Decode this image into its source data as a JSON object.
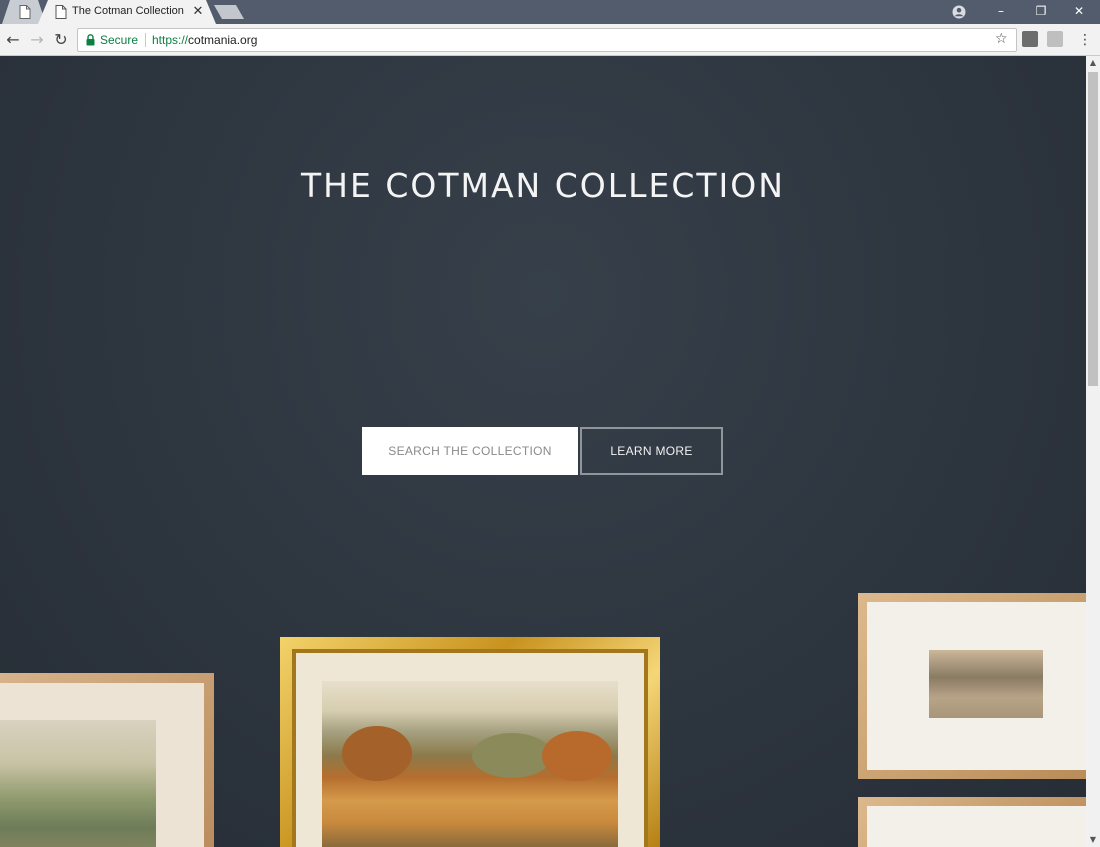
{
  "browser": {
    "tabs": [
      {
        "title": "",
        "active": false
      },
      {
        "title": "The Cotman Collection | ",
        "active": true
      }
    ],
    "tab_close_glyph": "✕",
    "window_controls": {
      "minimize": "–",
      "maximize": "❐",
      "close": "✕"
    },
    "nav": {
      "back": "←",
      "forward": "→",
      "reload": "↻"
    },
    "address_bar": {
      "security_label": "Secure",
      "url_scheme": "https://",
      "url_host": "cotmania.org"
    },
    "bookmark_glyph": "☆",
    "menu_glyph": "⋮",
    "icons": [
      "page-icon",
      "lock-icon",
      "star-icon",
      "profile-icon",
      "extension-icon",
      "menu-icon"
    ]
  },
  "page": {
    "hero_title": "THE COTMAN COLLECTION",
    "buttons": {
      "search": "SEARCH THE COLLECTION",
      "learn_more": "LEARN MORE"
    },
    "colors": {
      "wall": "#2d353f",
      "secure_green": "#0b8043",
      "gold_frame": "#d8a93a"
    }
  },
  "scrollbar": {
    "up": "▲",
    "down": "▼",
    "position": 0.0
  }
}
